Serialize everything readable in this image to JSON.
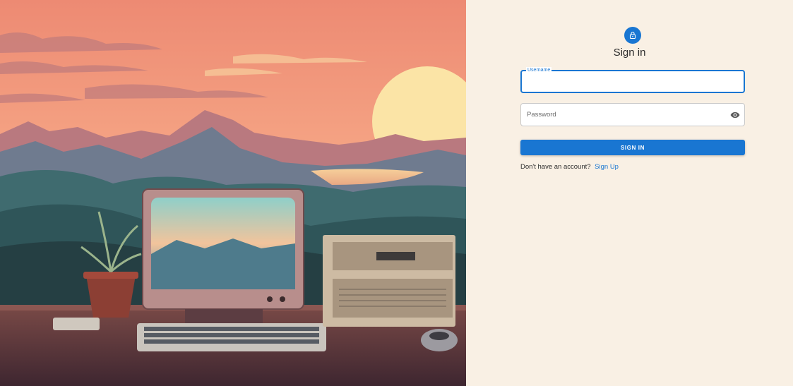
{
  "hero": {
    "image": "retro-computer-desk-sunset-illustration"
  },
  "auth": {
    "icon": "lock-icon",
    "title": "Sign in",
    "username_label": "Username",
    "username_value": "",
    "password_placeholder": "Password",
    "password_toggle_icon": "eye-icon",
    "submit_label": "SIGN IN",
    "no_account_text": "Don't have an account?",
    "signup_link": "Sign Up"
  },
  "colors": {
    "primary": "#1976d2",
    "panel_bg": "#f9f0e4"
  }
}
